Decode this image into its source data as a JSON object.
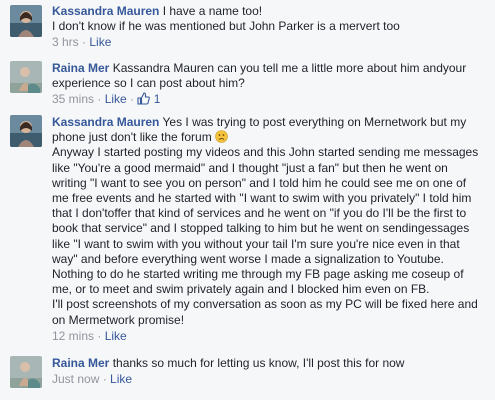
{
  "comments": [
    {
      "author": "Kassandra Mauren",
      "lines": [
        "I have a name too!",
        "I don't know if he was mentioned but John Parker is a mervert too"
      ],
      "time": "3 hrs",
      "like_label": "Like"
    },
    {
      "author": "Raina Mer",
      "lines": [
        "Kassandra Mauren can you tell me a little more about him andyour",
        "experience so I can post about him?"
      ],
      "time": "35 mins",
      "like_label": "Like",
      "like_count": "1"
    },
    {
      "author": "Kassandra Mauren",
      "lines": [
        "Yes I was trying to post everything on Mernetwork but my",
        "phone just don't like the forum",
        "Anyway I started posting my videos and this John started sending me messages",
        "like \"You're a good mermaid\" and I thought \"just a fan\" but then he went on",
        "writing \"I want to see you on person\" and I told him he could see me on one of",
        "me free events and he started with \"I want to swim with you privately\" I told him",
        "that I don'toffer that kind of services and he went on \"if you do I'll be the first to",
        "book that service\" and I stopped talking to him but he went on sendingessages",
        "like \"I want to swim with you without your tail I'm sure you're nice even in that",
        "way\" and before everything went worse I made a signalization to Youtube.",
        "Nothing to do he started writing me through my FB page asking me coseup of",
        "me, or to meet and swim privately again and I blocked him even on FB.",
        "I'll post screenshots of my conversation as soon as my PC will be fixed here and",
        "on Mermetwork promise!"
      ],
      "time": "12 mins",
      "like_label": "Like"
    },
    {
      "author": "Raina Mer",
      "lines": [
        "thanks so much for letting us know, I'll post this for now"
      ],
      "time": "Just now",
      "like_label": "Like"
    }
  ],
  "separator": "·",
  "colors": {
    "name": "#365899",
    "meta": "#90949c",
    "background": "#f6f7f9"
  }
}
